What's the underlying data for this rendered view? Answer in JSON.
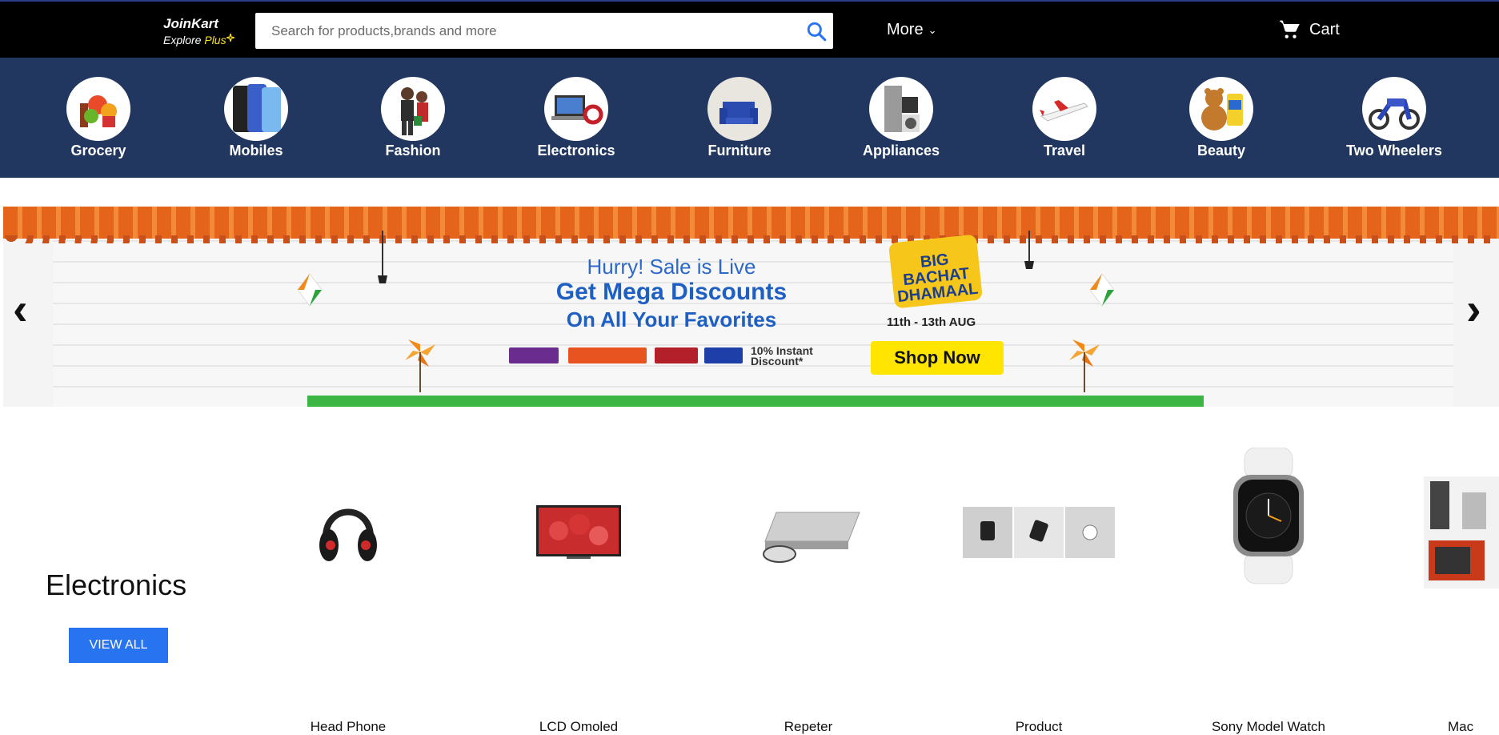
{
  "header": {
    "logo_name": "JoinKart",
    "logo_tag_prefix": "Explore ",
    "logo_tag_plus": "Plus",
    "search_placeholder": "Search for products,brands and more",
    "more_label": "More",
    "cart_label": "Cart"
  },
  "categories": [
    {
      "label": "Grocery",
      "icon": "grocery-icon"
    },
    {
      "label": "Mobiles",
      "icon": "mobiles-icon"
    },
    {
      "label": "Fashion",
      "icon": "fashion-icon"
    },
    {
      "label": "Electronics",
      "icon": "electronics-icon"
    },
    {
      "label": "Furniture",
      "icon": "furniture-icon"
    },
    {
      "label": "Appliances",
      "icon": "appliances-icon"
    },
    {
      "label": "Travel",
      "icon": "travel-icon"
    },
    {
      "label": "Beauty",
      "icon": "beauty-icon"
    },
    {
      "label": "Two Wheelers",
      "icon": "two-wheelers-icon"
    }
  ],
  "banner": {
    "line1": "Hurry! Sale is Live",
    "line2": "Get Mega Discounts",
    "line3": "On All Your Favorites",
    "badge_line1": "BIG",
    "badge_line2": "BACHAT",
    "badge_line3": "DHAMAAL",
    "dates": "11th - 13th AUG",
    "instant_line1": "10% Instant",
    "instant_line2": "Discount*",
    "cta": "Shop Now",
    "prev_icon": "chevron-left-icon",
    "next_icon": "chevron-right-icon"
  },
  "section": {
    "title": "Electronics",
    "view_all": "VIEW ALL",
    "products": [
      {
        "name": "Head Phone"
      },
      {
        "name": "LCD Omoled"
      },
      {
        "name": "Repeter"
      },
      {
        "name": "Product"
      },
      {
        "name": "Sony Model Watch"
      },
      {
        "name": "Mac"
      }
    ]
  },
  "colors": {
    "topbar": "#000000",
    "category_bar": "#223760",
    "accent_blue": "#2874f0",
    "plus_yellow": "#ffe11b",
    "shop_now": "#ffe500"
  }
}
